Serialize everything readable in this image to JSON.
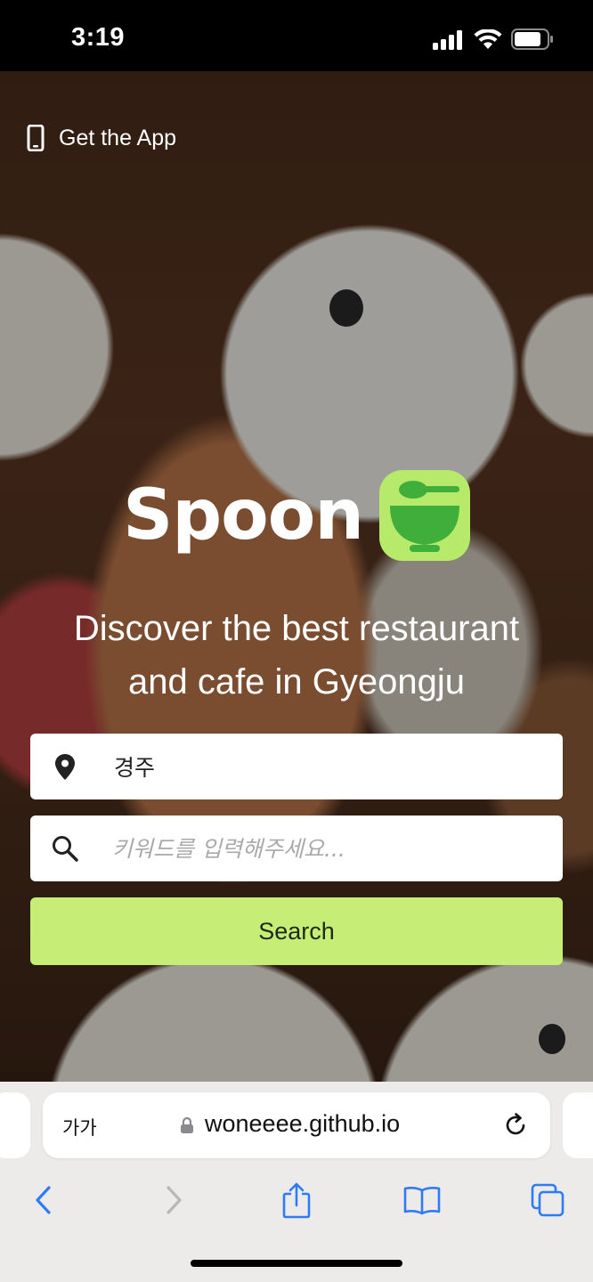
{
  "status_bar": {
    "time": "3:19",
    "icons": [
      "signal-icon",
      "wifi-icon",
      "battery-icon"
    ]
  },
  "hero": {
    "get_app_label": "Get the App",
    "brand_name": "Spoon",
    "tagline_line1": "Discover the best restaurant",
    "tagline_line2": "and cafe in Gyeongju",
    "location_value": "경주",
    "keyword_placeholder": "키워드를 입력해주세요...",
    "search_button_label": "Search",
    "colors": {
      "accent": "#c6ee77",
      "logo_bg": "#b7ea6a",
      "logo_fg": "#3fae3a"
    }
  },
  "browser": {
    "aa_label": "가가",
    "url": "woneeee.github.io",
    "toolbar_icons": [
      "back-icon",
      "forward-icon",
      "share-icon",
      "bookmarks-icon",
      "tabs-icon"
    ],
    "colors": {
      "tint": "#2f7bf6",
      "disabled": "#b7b7bb"
    }
  }
}
